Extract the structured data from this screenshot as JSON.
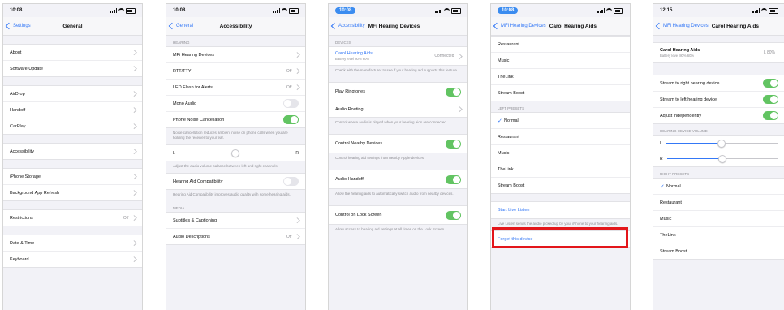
{
  "screens": [
    {
      "time": "10:08",
      "back": "Settings",
      "title": "General",
      "groups": [
        [
          "About",
          "Software Update"
        ],
        [
          "AirDrop",
          "Handoff",
          "CarPlay"
        ],
        [
          "Accessibility"
        ],
        [
          "iPhone Storage",
          "Background App Refresh"
        ],
        [
          "Restrictions"
        ],
        [
          "Date & Time",
          "Keyboard"
        ]
      ],
      "restrictions_value": "Off"
    },
    {
      "time": "10:08",
      "back": "General",
      "title": "Accessibility",
      "header1": "HEARING",
      "rows1": [
        "MFi Hearing Devices",
        "RTT/TTY",
        "LED Flash for Alerts",
        "Mono Audio",
        "Phone Noise Cancellation"
      ],
      "rttty_value": "Off",
      "led_value": "Off",
      "footer1": "Noise cancellation reduces ambient noise on phone calls when you are holding the receiver to your ear.",
      "slider_left": "L",
      "slider_right": "R",
      "footer2": "Adjust the audio volume balance between left and right channels.",
      "row_hac": "Hearing Aid Compatibility",
      "footer3": "Hearing Aid Compatibility improves audio quality with some hearing aids.",
      "header2": "MEDIA",
      "rows2": [
        "Subtitles & Captioning",
        "Audio Descriptions"
      ],
      "ad_value": "Off"
    },
    {
      "time": "10:08",
      "back": "Accessibility",
      "title": "MFi Hearing Devices",
      "header1": "DEVICES",
      "device_name": "Carol Hearing Aids",
      "device_sub": "Battery level 80% 60%",
      "device_status": "Connected",
      "footer1": "Check with the manufacturer to see if your hearing aid supports this feature.",
      "rows": [
        {
          "label": "Play Ringtones",
          "footer": ""
        },
        {
          "label": "Audio Routing",
          "footer": "Control where audio is played when your hearing aids are connected."
        },
        {
          "label": "Control Nearby Devices",
          "footer": "Control hearing aid settings from nearby Apple devices."
        },
        {
          "label": "Audio Handoff",
          "footer": "Allow the hearing aids to automatically switch audio from nearby devices."
        },
        {
          "label": "Control on Lock Screen",
          "footer": "Allow access to hearing aid settings at all times on the Lock Screen."
        }
      ]
    },
    {
      "time": "10:08",
      "back": "MFi Hearing Devices",
      "title": "Carol Hearing Aids",
      "rows1": [
        "Restaurant",
        "Music",
        "TheLink",
        "Stream Boost"
      ],
      "header2": "LEFT PRESETS",
      "rows2": [
        "Normal",
        "Restaurant",
        "Music",
        "TheLink",
        "Stream Boost"
      ],
      "live_listen": "Start Live Listen",
      "footer": "Live Listen sends the audio picked up by your iPhone to your hearing aids.",
      "forget": "Forget this device"
    },
    {
      "time": "12:15",
      "back": "MFi Hearing Devices",
      "title": "Carol Hearing Aids",
      "device_name": "Carol Hearing Aids",
      "device_sub": "Battery level 80% 60%",
      "device_battery": "L 80%",
      "toggles": [
        "Stream to right hearing device",
        "Stream to left hearing device",
        "Adjust independently"
      ],
      "header2": "HEARING DEVICE VOLUME",
      "slider_left": "L",
      "slider_right": "R",
      "header3": "RIGHT PRESETS",
      "rows3": [
        "Normal",
        "Restaurant",
        "Music",
        "TheLink",
        "Stream Boost"
      ]
    }
  ],
  "colors": {
    "accent": "#3478f6",
    "toggle_on": "#62c462",
    "highlight": "#e3161b"
  }
}
